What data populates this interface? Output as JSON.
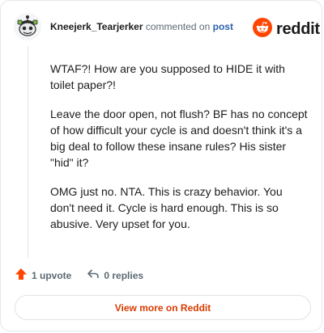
{
  "comment": {
    "username": "Kneejerk_Tearjerker",
    "action_text": "commented on",
    "post_link": "post",
    "paragraphs": [
      "WTAF?! How are you supposed to HIDE it with toilet paper?!",
      "Leave the door open, not flush? BF has no concept of how difficult your cycle is and doesn't think it's a big deal to follow these insane rules? His sister \"hid\" it?",
      "OMG just no. NTA. This is crazy behavior. You don't need it. Cycle is hard enough. This is so abusive. Very upset for you."
    ]
  },
  "brand": {
    "name": "reddit",
    "icon": "reddit-logo-icon",
    "color": "#ff4500"
  },
  "actions": {
    "upvote_label": "1 upvote",
    "upvote_icon": "upvote-arrow-icon",
    "upvote_color": "#ff4500",
    "replies_label": "0 replies",
    "reply_icon": "reply-arrow-icon"
  },
  "footer": {
    "view_more_label": "View more on Reddit",
    "accent_color": "#d93a00"
  }
}
